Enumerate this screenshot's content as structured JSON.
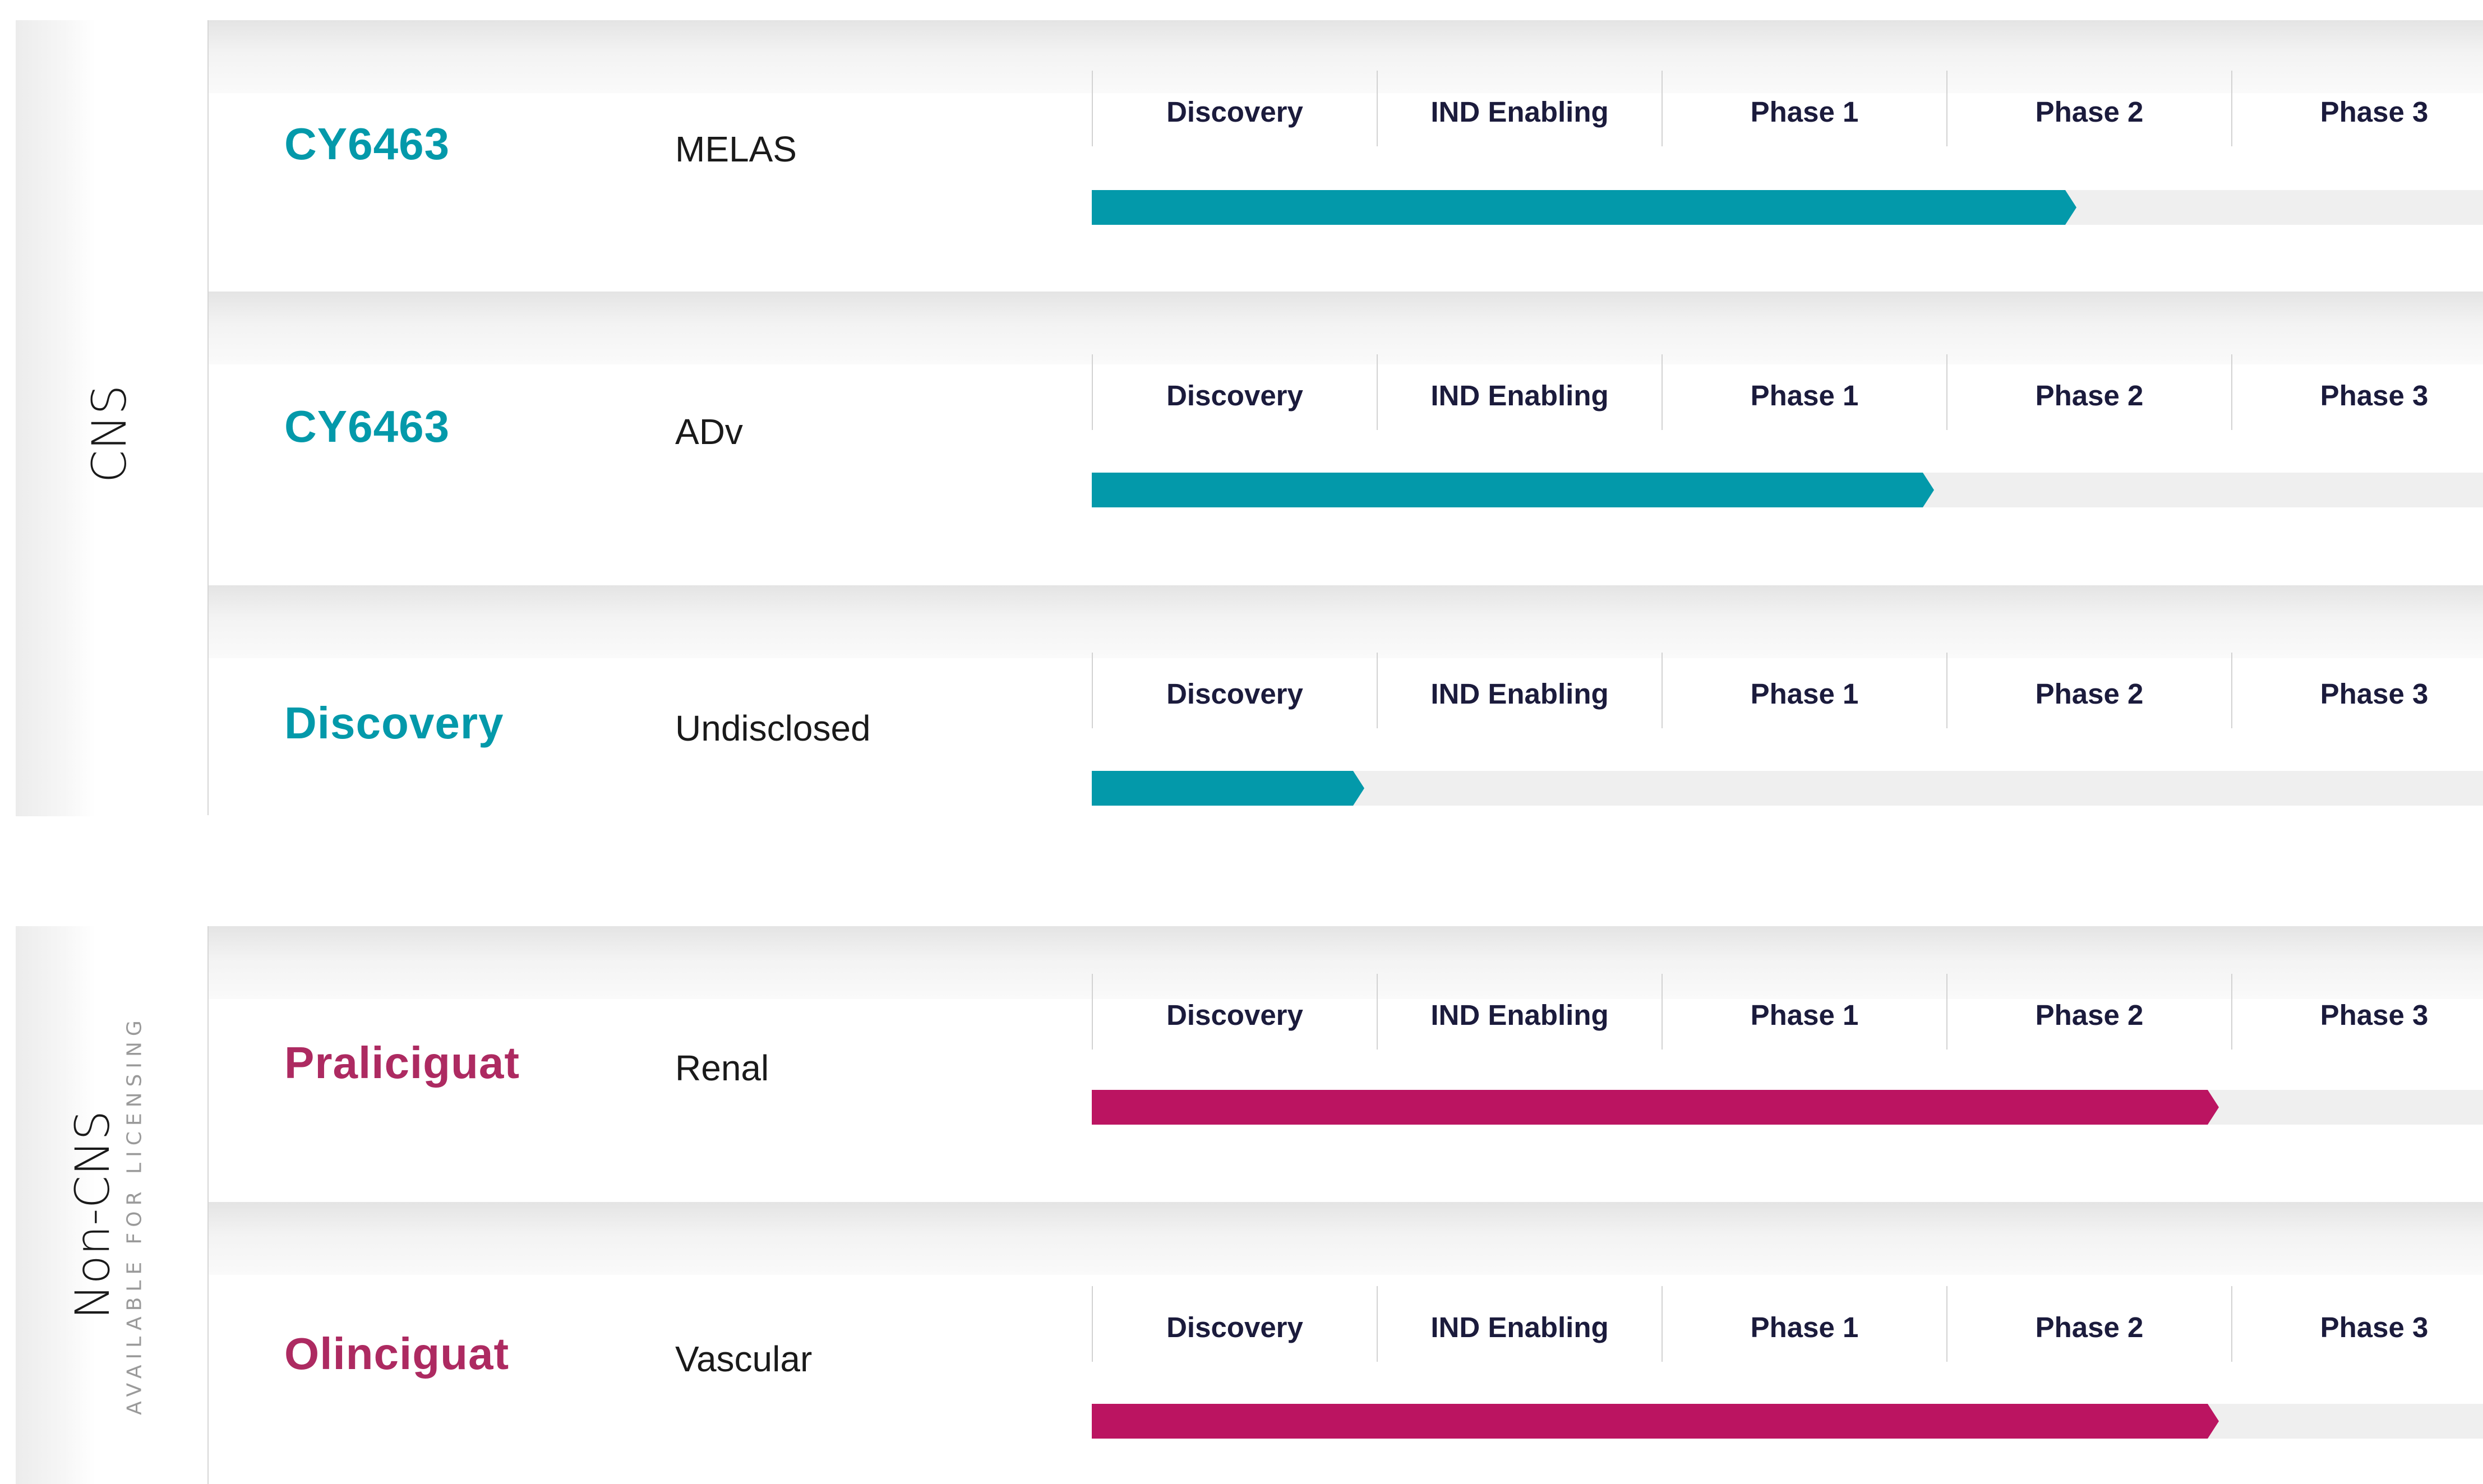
{
  "stages": [
    "Discovery",
    "IND Enabling",
    "Phase 1",
    "Phase 2",
    "Phase 3"
  ],
  "colors": {
    "cns_accent": "#0399aa",
    "noncns_text": "#ad2a61",
    "noncns_bar": "#bb1461",
    "track": "#efefef",
    "stage_text": "#1b1b3c"
  },
  "sections": [
    {
      "label": "CNS",
      "sublabel": "",
      "rows": [
        {
          "name": "CY6463",
          "indication": "MELAS",
          "progress_stages": 3.5
        },
        {
          "name": "CY6463",
          "indication": "ADv",
          "progress_stages": 3.0
        },
        {
          "name": "Discovery",
          "indication": "Undisclosed",
          "progress_stages": 1.0
        }
      ]
    },
    {
      "label": "Non-CNS",
      "sublabel": "AVAILABLE FOR LICENSING",
      "rows": [
        {
          "name": "Praliciguat",
          "indication": "Renal",
          "progress_stages": 4.0
        },
        {
          "name": "Olinciguat",
          "indication": "Vascular",
          "progress_stages": 4.0
        }
      ]
    }
  ]
}
